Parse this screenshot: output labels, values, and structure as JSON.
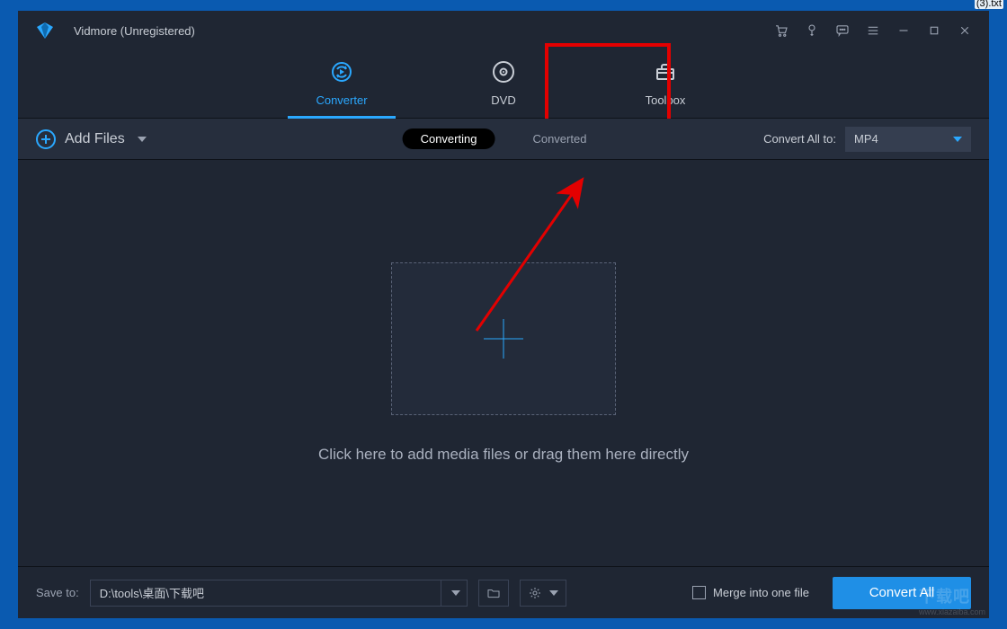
{
  "desktop": {
    "stray_filename": "(3).txt"
  },
  "titlebar": {
    "app_name": "Vidmore (Unregistered)"
  },
  "main_tabs": [
    {
      "id": "converter",
      "label": "Converter",
      "active": true
    },
    {
      "id": "dvd",
      "label": "DVD",
      "active": false
    },
    {
      "id": "toolbox",
      "label": "Toolbox",
      "active": false
    }
  ],
  "toolbar": {
    "add_files_label": "Add Files",
    "segments": {
      "converting": "Converting",
      "converted": "Converted"
    },
    "convert_all_to_label": "Convert All to:",
    "format_selected": "MP4"
  },
  "drop_area": {
    "hint": "Click here to add media files or drag them here directly"
  },
  "bottom": {
    "save_to_label": "Save to:",
    "save_path": "D:\\tools\\桌面\\下载吧",
    "merge_label": "Merge into one file",
    "convert_all_button": "Convert All"
  },
  "annotation": {
    "highlight_target": "toolbox-tab"
  },
  "watermark": {
    "main": "下载吧",
    "sub": "www.xiazaiba.com"
  }
}
